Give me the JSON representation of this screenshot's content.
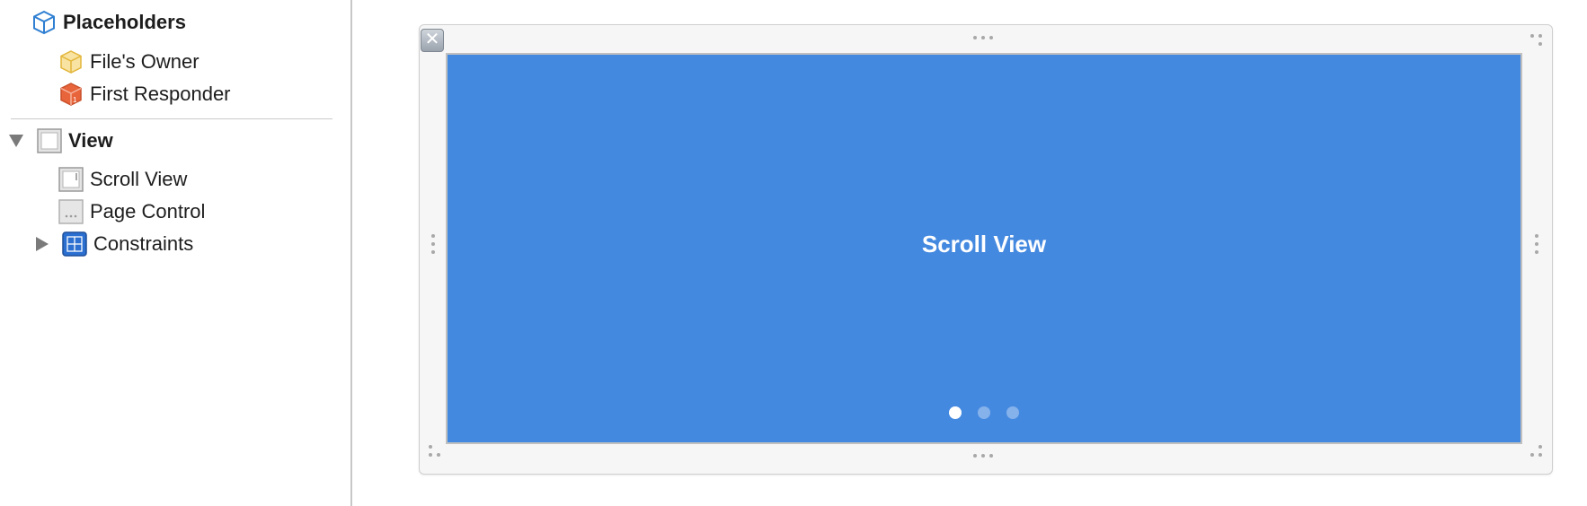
{
  "outline": {
    "placeholders_label": "Placeholders",
    "files_owner_label": "File's Owner",
    "first_responder_label": "First Responder",
    "view_label": "View",
    "scroll_view_label": "Scroll View",
    "page_control_label": "Page Control",
    "constraints_label": "Constraints",
    "icons": {
      "placeholders": "cube-outline-icon",
      "files_owner": "yellow-cube-icon",
      "first_responder": "orange-cube-icon",
      "view": "view-icon",
      "scroll_view": "scroll-view-icon",
      "page_control": "page-control-icon",
      "constraints": "constraints-icon"
    }
  },
  "canvas": {
    "scroll_view_label": "Scroll View",
    "close_glyph": "✕",
    "page_control": {
      "pages": 3,
      "current_page": 1
    }
  },
  "colors": {
    "scroll_view_fill": "#4489e0",
    "accent_blue": "#2f7fd2",
    "files_owner_yellow": "#f5cf59",
    "first_responder_orange": "#e8643a"
  }
}
